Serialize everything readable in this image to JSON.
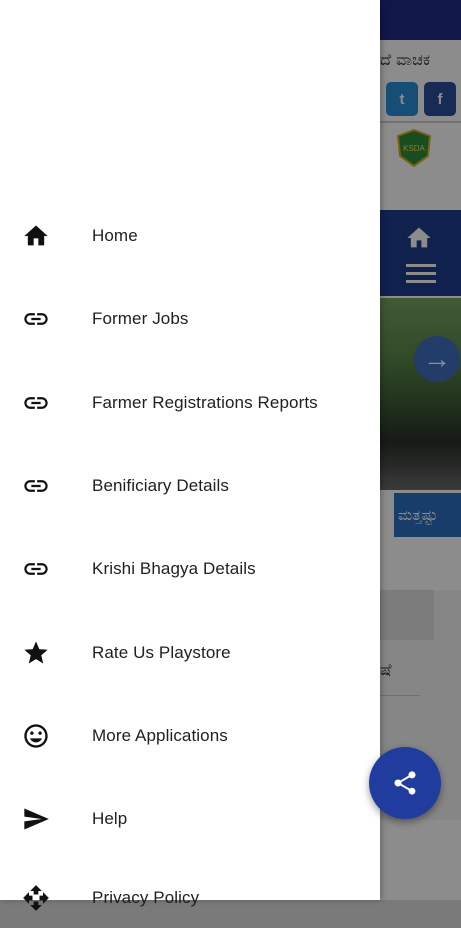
{
  "background": {
    "header_kannada": "ದೆ ವಾಚಕ",
    "social": {
      "twitter_glyph": "t",
      "facebook_glyph": "f"
    },
    "logo_text": "KSDA",
    "more_button_label": "ಮತ್ತಷ್ಟು",
    "card_text": "ಷೆ",
    "brand_color": "#1f3c8f"
  },
  "drawer": {
    "items": [
      {
        "label": "Home",
        "icon": "home-icon"
      },
      {
        "label": "Former Jobs",
        "icon": "link-icon"
      },
      {
        "label": "Farmer Registrations Reports",
        "icon": "link-icon"
      },
      {
        "label": "Benificiary Details",
        "icon": "link-icon"
      },
      {
        "label": "Krishi Bhagya Details",
        "icon": "link-icon"
      },
      {
        "label": "Rate Us Playstore",
        "icon": "star-icon"
      },
      {
        "label": "More Applications",
        "icon": "smiley-icon"
      },
      {
        "label": "Help",
        "icon": "send-icon"
      },
      {
        "label": "Privacy Policy",
        "icon": "move-icon"
      }
    ]
  },
  "fab": {
    "icon": "share-icon"
  }
}
